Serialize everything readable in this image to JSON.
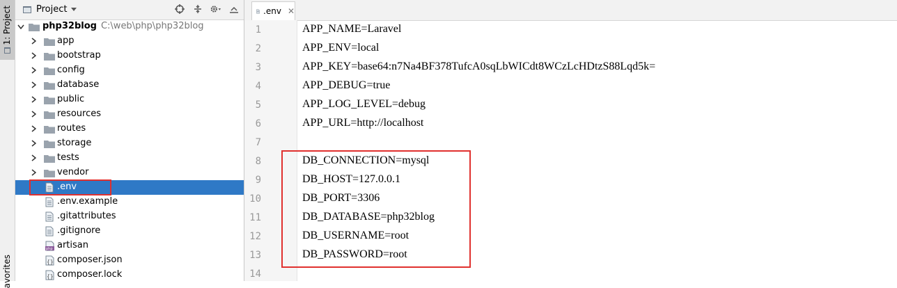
{
  "left_strip": {
    "project_tab": "1: Project",
    "favorites_tab": "avorites"
  },
  "project_panel": {
    "title": "Project",
    "root": {
      "name": "php32blog",
      "path": "C:\\web\\php\\php32blog"
    },
    "folders": [
      "app",
      "bootstrap",
      "config",
      "database",
      "public",
      "resources",
      "routes",
      "storage",
      "tests",
      "vendor"
    ],
    "files": [
      ".env",
      ".env.example",
      ".gitattributes",
      ".gitignore",
      "artisan",
      "composer.json",
      "composer.lock"
    ],
    "selected_file": ".env"
  },
  "editor": {
    "tab_label": ".env",
    "line_numbers": [
      "1",
      "2",
      "3",
      "4",
      "5",
      "6",
      "7",
      "8",
      "9",
      "10",
      "11",
      "12",
      "13",
      "14"
    ],
    "lines": [
      "APP_NAME=Laravel",
      "APP_ENV=local",
      "APP_KEY=base64:n7Na4BF378TufcA0sqLbWICdt8WCzLcHDtzS88Lqd5k=",
      "APP_DEBUG=true",
      "APP_LOG_LEVEL=debug",
      "APP_URL=http://localhost",
      "",
      "DB_CONNECTION=mysql",
      "DB_HOST=127.0.0.1",
      "DB_PORT=3306",
      "DB_DATABASE=php32blog",
      "DB_USERNAME=root",
      "DB_PASSWORD=root",
      ""
    ]
  },
  "colors": {
    "selection": "#2f79c6",
    "highlight_box": "#e0302e",
    "folder": "#9aa3ad"
  }
}
